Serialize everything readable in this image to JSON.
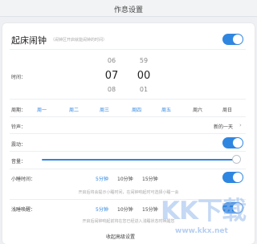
{
  "header": {
    "title": "作息设置"
  },
  "alarm": {
    "title": "起床闹钟",
    "hint": "（闹钟区开启就能闹钟的时间）",
    "enabled": true
  },
  "time_picker": {
    "label": "时间：",
    "hours": [
      "06",
      "07",
      "08"
    ],
    "minutes": [
      "59",
      "00",
      "01"
    ]
  },
  "days": {
    "label": "周期：",
    "items": [
      {
        "label": "周一",
        "active": true
      },
      {
        "label": "周二",
        "active": true
      },
      {
        "label": "周三",
        "active": true
      },
      {
        "label": "周四",
        "active": true
      },
      {
        "label": "周五",
        "active": true
      },
      {
        "label": "周六",
        "active": false
      },
      {
        "label": "周日",
        "active": false
      }
    ]
  },
  "ringtone": {
    "label": "铃声：",
    "value": "新的一天"
  },
  "vibration": {
    "label": "震动：",
    "enabled": true
  },
  "volume": {
    "label": "音量：",
    "level_percent": 100
  },
  "snooze": {
    "label": "小睡时间：",
    "options": [
      "5分钟",
      "10分钟",
      "15分钟"
    ],
    "selected": "5分钟",
    "enabled": true,
    "description": "开启后将会提示小睡时间，在闹钟响起时可选择小睡一会"
  },
  "light_wake": {
    "label": "浅睡唤醒：",
    "options": [
      "5分钟",
      "10分钟",
      "15分钟"
    ],
    "selected": "5分钟",
    "enabled": true,
    "description": "开启后闹钟响起前将在您已经进入浅睡状态时唤醒您"
  },
  "footer": {
    "link": "收起高级设置"
  },
  "watermark": {
    "text": "KK下载",
    "url": "www.kkx.net"
  },
  "colors": {
    "accent": "#2f86e0",
    "background": "#eef0f3",
    "card": "#ffffff"
  }
}
